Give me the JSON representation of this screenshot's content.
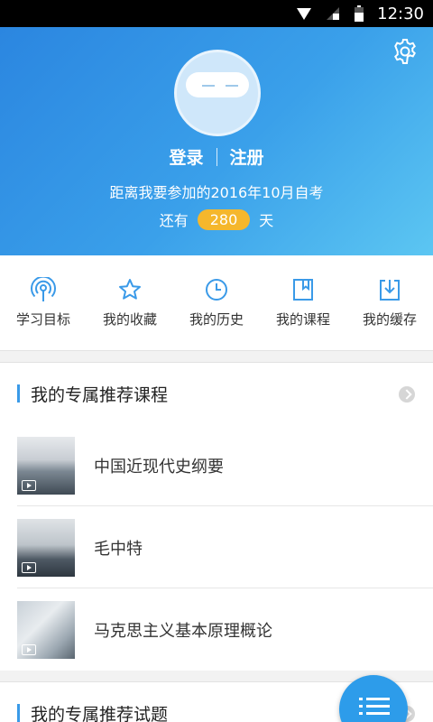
{
  "status_bar": {
    "time": "12:30"
  },
  "header": {
    "login_label": "登录",
    "register_label": "注册",
    "exam_text": "距离我要参加的2016年10月自考",
    "count_prefix": "还有",
    "days_remaining": "280",
    "count_suffix": "天"
  },
  "menu": [
    {
      "label": "学习目标",
      "icon": "target-icon"
    },
    {
      "label": "我的收藏",
      "icon": "star-icon"
    },
    {
      "label": "我的历史",
      "icon": "clock-icon"
    },
    {
      "label": "我的课程",
      "icon": "book-icon"
    },
    {
      "label": "我的缓存",
      "icon": "download-icon"
    }
  ],
  "courses_section": {
    "title": "我的专属推荐课程",
    "items": [
      {
        "name": "中国近现代史纲要"
      },
      {
        "name": "毛中特"
      },
      {
        "name": "马克思主义基本原理概论"
      }
    ]
  },
  "exercises_section": {
    "title": "我的专属推荐试题"
  },
  "colors": {
    "accent": "#2d9cea",
    "badge": "#f5b72c"
  }
}
